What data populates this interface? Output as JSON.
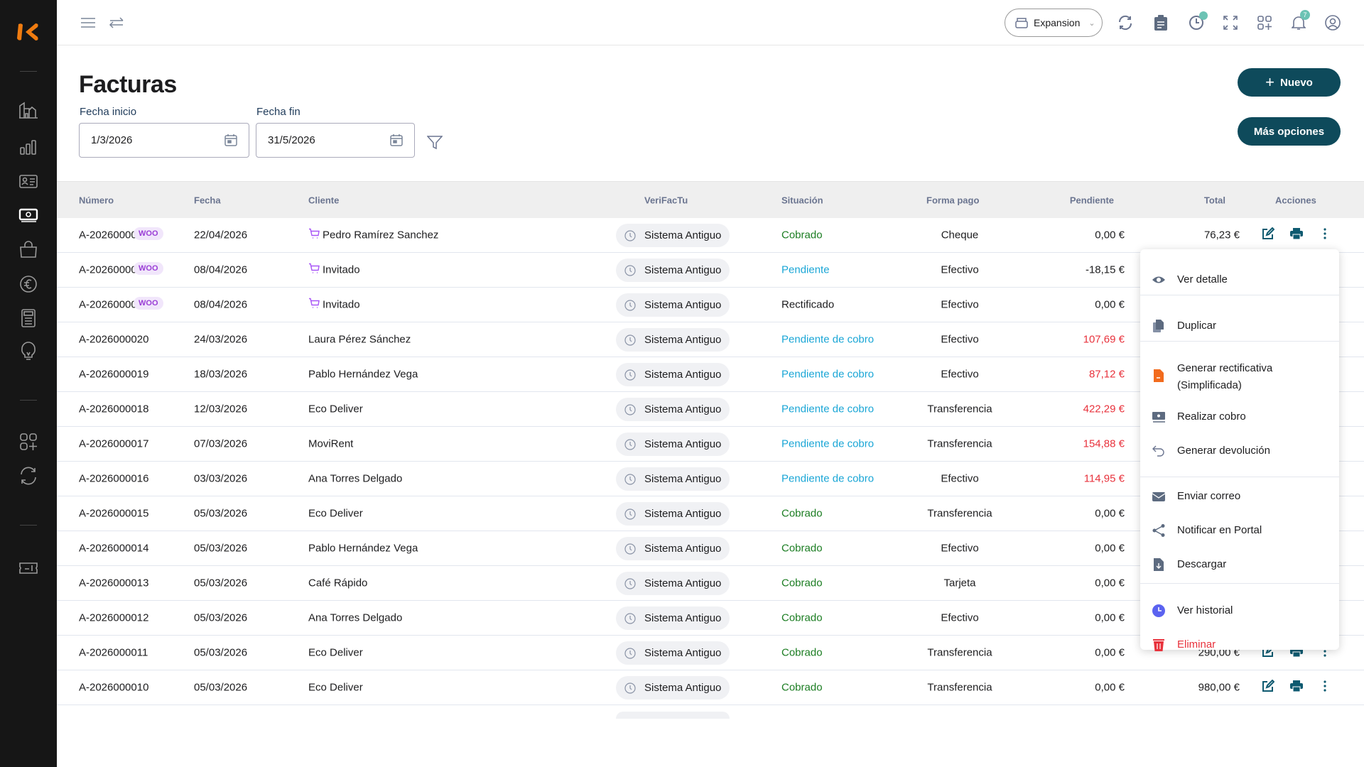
{
  "brand": {
    "accent": "#f07c10",
    "primary": "#0e4a5b"
  },
  "sidebar": {
    "items": [
      "dashboard-icon",
      "stats-icon",
      "contacts-icon",
      "invoices-icon",
      "shopping-bag-icon",
      "euro-icon",
      "calculator-icon",
      "lightbulb-icon",
      "apps-add-icon",
      "sync-icon",
      "ticket-icon"
    ],
    "active": "invoices-icon"
  },
  "topbar": {
    "company": "Expansion",
    "notifications_count": "7"
  },
  "page": {
    "title": "Facturas",
    "fecha_inicio_label": "Fecha inicio",
    "fecha_inicio": "1/3/2026",
    "fecha_fin_label": "Fecha fin",
    "fecha_fin": "31/5/2026",
    "nuevo": "Nuevo",
    "mas_opciones": "Más opciones"
  },
  "table": {
    "headers": {
      "numero": "Número",
      "fecha": "Fecha",
      "cliente": "Cliente",
      "verifactu": "VeriFacTu",
      "situacion": "Situación",
      "forma_pago": "Forma pago",
      "pendiente": "Pendiente",
      "total": "Total",
      "acciones": "Acciones"
    },
    "status_colors": {
      "Cobrado": "#1b7d22",
      "Pendiente": "#1aa6d6",
      "Pendiente de cobro": "#1aa6d6",
      "Rectificado": "#1d1d1f"
    },
    "rows": [
      {
        "numero": "A-2026000023",
        "woo": "WOO",
        "fecha": "22/04/2026",
        "cliente": "Pedro Ramírez Sanchez",
        "cart": true,
        "verifactu": "Sistema Antiguo",
        "situacion": "Cobrado",
        "forma_pago": "Cheque",
        "pendiente": "0,00 €",
        "pend_red": false,
        "total": "76,23 €"
      },
      {
        "numero": "A-2026000022",
        "woo": "WOO",
        "fecha": "08/04/2026",
        "cliente": "Invitado",
        "cart": true,
        "verifactu": "Sistema Antiguo",
        "situacion": "Pendiente",
        "forma_pago": "Efectivo",
        "pendiente": "-18,15 €",
        "pend_red": false
      },
      {
        "numero": "A-2026000021",
        "woo": "WOO",
        "fecha": "08/04/2026",
        "cliente": "Invitado",
        "cart": true,
        "verifactu": "Sistema Antiguo",
        "situacion": "Rectificado",
        "forma_pago": "Efectivo",
        "pendiente": "0,00 €",
        "pend_red": false
      },
      {
        "numero": "A-2026000020",
        "fecha": "24/03/2026",
        "cliente": "Laura Pérez Sánchez",
        "verifactu": "Sistema Antiguo",
        "situacion": "Pendiente de cobro",
        "forma_pago": "Efectivo",
        "pendiente": "107,69 €",
        "pend_red": true
      },
      {
        "numero": "A-2026000019",
        "fecha": "18/03/2026",
        "cliente": "Pablo Hernández Vega",
        "verifactu": "Sistema Antiguo",
        "situacion": "Pendiente de cobro",
        "forma_pago": "Efectivo",
        "pendiente": "87,12 €",
        "pend_red": true
      },
      {
        "numero": "A-2026000018",
        "fecha": "12/03/2026",
        "cliente": "Eco Deliver",
        "verifactu": "Sistema Antiguo",
        "situacion": "Pendiente de cobro",
        "forma_pago": "Transferencia",
        "pendiente": "422,29 €",
        "pend_red": true
      },
      {
        "numero": "A-2026000017",
        "fecha": "07/03/2026",
        "cliente": "MoviRent",
        "verifactu": "Sistema Antiguo",
        "situacion": "Pendiente de cobro",
        "forma_pago": "Transferencia",
        "pendiente": "154,88 €",
        "pend_red": true
      },
      {
        "numero": "A-2026000016",
        "fecha": "03/03/2026",
        "cliente": "Ana Torres Delgado",
        "verifactu": "Sistema Antiguo",
        "situacion": "Pendiente de cobro",
        "forma_pago": "Efectivo",
        "pendiente": "114,95 €",
        "pend_red": true
      },
      {
        "numero": "A-2026000015",
        "fecha": "05/03/2026",
        "cliente": "Eco Deliver",
        "verifactu": "Sistema Antiguo",
        "situacion": "Cobrado",
        "forma_pago": "Transferencia",
        "pendiente": "0,00 €",
        "pend_red": false
      },
      {
        "numero": "A-2026000014",
        "fecha": "05/03/2026",
        "cliente": "Pablo Hernández Vega",
        "verifactu": "Sistema Antiguo",
        "situacion": "Cobrado",
        "forma_pago": "Efectivo",
        "pendiente": "0,00 €",
        "pend_red": false
      },
      {
        "numero": "A-2026000013",
        "fecha": "05/03/2026",
        "cliente": "Café Rápido",
        "verifactu": "Sistema Antiguo",
        "situacion": "Cobrado",
        "forma_pago": "Tarjeta",
        "pendiente": "0,00 €",
        "pend_red": false
      },
      {
        "numero": "A-2026000012",
        "fecha": "05/03/2026",
        "cliente": "Ana Torres Delgado",
        "verifactu": "Sistema Antiguo",
        "situacion": "Cobrado",
        "forma_pago": "Efectivo",
        "pendiente": "0,00 €",
        "pend_red": false
      },
      {
        "numero": "A-2026000011",
        "fecha": "05/03/2026",
        "cliente": "Eco Deliver",
        "verifactu": "Sistema Antiguo",
        "situacion": "Cobrado",
        "forma_pago": "Transferencia",
        "pendiente": "0,00 €",
        "pend_red": false,
        "total": "290,00 €"
      },
      {
        "numero": "A-2026000010",
        "fecha": "05/03/2026",
        "cliente": "Eco Deliver",
        "verifactu": "Sistema Antiguo",
        "situacion": "Cobrado",
        "forma_pago": "Transferencia",
        "pendiente": "0,00 €",
        "pend_red": false,
        "total": "980,00 €"
      }
    ]
  },
  "menu": {
    "items": [
      {
        "label": "Ver detalle",
        "icon": "eye-icon"
      },
      {
        "label": "Duplicar",
        "icon": "duplicate-icon"
      },
      {
        "label": "Generar rectificativa",
        "label2": "(Simplificada)",
        "icon": "file-minus-icon",
        "color": "#f26b1d"
      },
      {
        "label": "Realizar cobro",
        "icon": "money-icon"
      },
      {
        "label": "Generar devolución",
        "icon": "undo-icon"
      },
      {
        "label": "Enviar correo",
        "icon": "mail-icon"
      },
      {
        "label": "Notificar en Portal",
        "icon": "share-icon"
      },
      {
        "label": "Descargar",
        "icon": "download-file-icon"
      },
      {
        "label": "Ver historial",
        "icon": "clock-icon",
        "color": "#5b63f0"
      },
      {
        "label": "Eliminar",
        "icon": "trash-icon",
        "color": "#e8323c",
        "danger": true
      }
    ]
  }
}
